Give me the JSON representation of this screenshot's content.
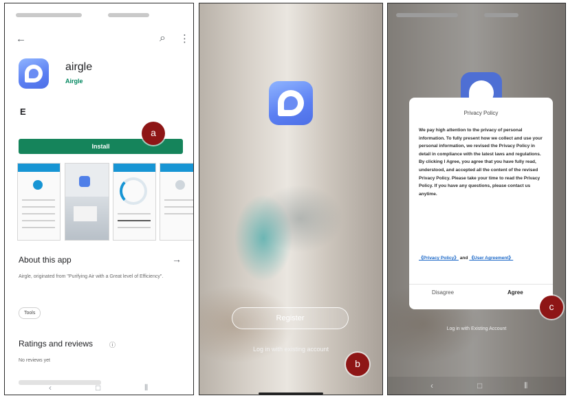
{
  "badges": {
    "a": "a",
    "b": "b",
    "c": "c"
  },
  "icons": {
    "back": "←",
    "search": "⌕",
    "more": "⋮",
    "arrow_right": "→",
    "info": "ⓘ",
    "rating": "E",
    "nav_back": "‹",
    "nav_home": "□",
    "nav_recents": "⦀"
  },
  "store": {
    "app_name": "airgle",
    "developer": "Airgle",
    "install_label": "Install",
    "about_title": "About this app",
    "about_desc": "Airgle, originated from \"Purifying Air with a Great level of Efficiency\".",
    "tag": "Tools",
    "ratings_title": "Ratings and reviews",
    "no_reviews": "No reviews yet"
  },
  "launch": {
    "register_label": "Register",
    "login_label": "Log in with existing account"
  },
  "privacy": {
    "title": "Privacy Policy",
    "body": "We pay high attention to the privacy of personal information. To fully present how we collect and use your personal information, we revised the Privacy Policy in detail in compliance with the latest laws and regulations. By clicking I Agree, you agree that you have fully read, understood, and accepted all the content of the revised Privacy Policy. Please take your time to read the Privacy Policy. If you have any questions, please contact us anytime.",
    "link_privacy": "《Privacy Policy》",
    "link_and": "and",
    "link_user": "《User Agreement》",
    "disagree_label": "Disagree",
    "agree_label": "Agree",
    "behind_login": "Log in with Existing Account"
  },
  "colors": {
    "install_green": "#15845b",
    "developer_green": "#01875f",
    "badge_red": "#8e1616",
    "app_icon_blue": "#5b7ff2",
    "link_blue": "#1a67c7"
  }
}
